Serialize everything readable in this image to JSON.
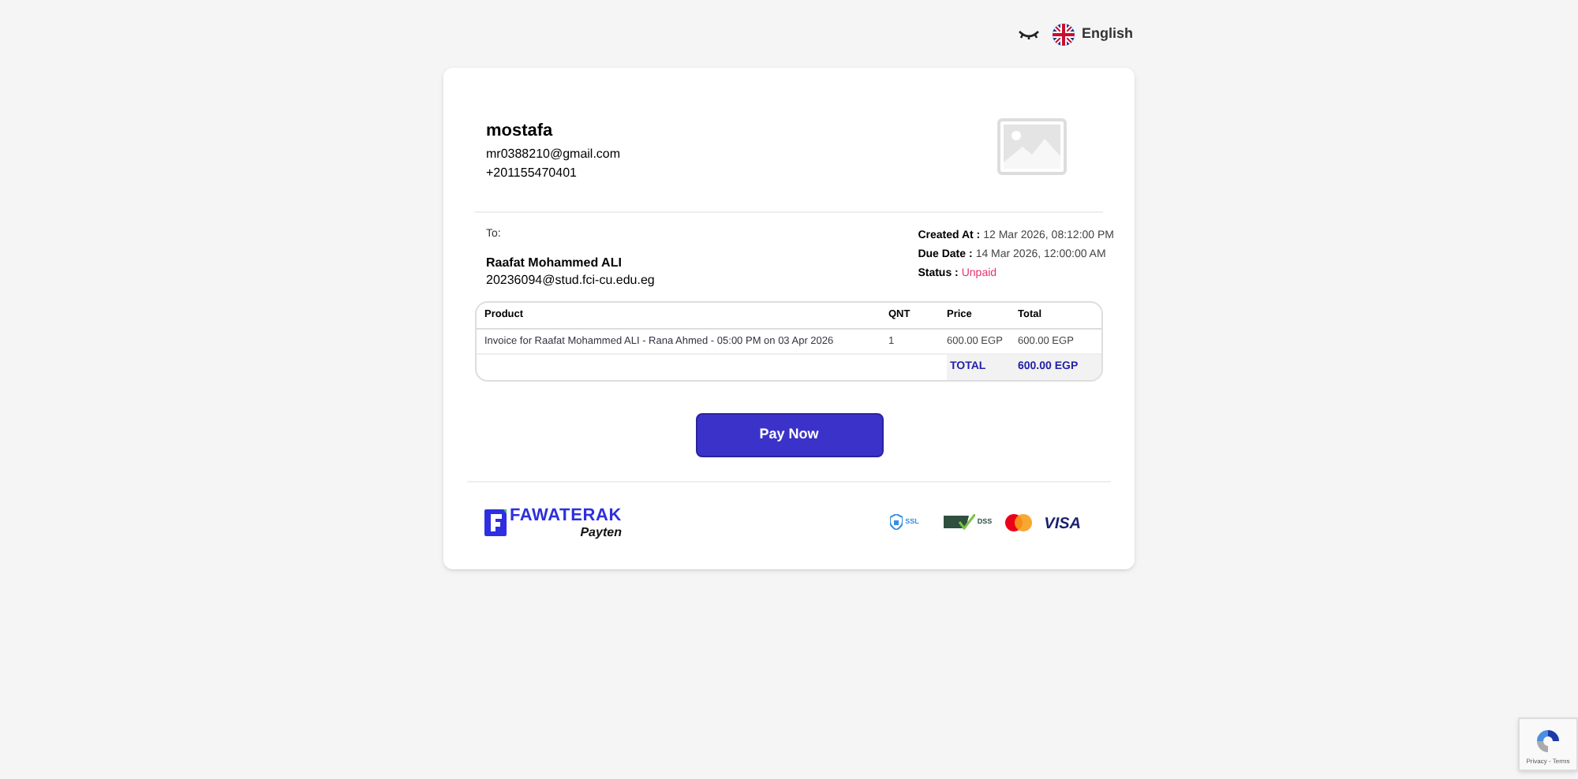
{
  "language": {
    "label": "English"
  },
  "seller": {
    "name": "mostafa",
    "email": "mr0388210@gmail.com",
    "phone": "+201155470401"
  },
  "recipient": {
    "label": "To:",
    "name": "Raafat Mohammed ALI",
    "email": "20236094@stud.fci-cu.edu.eg"
  },
  "meta": [
    {
      "label": "Created At :",
      "value": "12 Mar 2026, 08:12:00 PM",
      "kind": "plain"
    },
    {
      "label": "Due Date :",
      "value": "14 Mar 2026, 12:00:00 AM",
      "kind": "plain"
    },
    {
      "label": "Status :",
      "value": "Unpaid",
      "kind": "alert"
    }
  ],
  "table": {
    "columns": [
      "Product",
      "QNT",
      "Price",
      "Total"
    ],
    "rows": [
      [
        "Invoice for Raafat Mohammed ALI - Rana Ahmed - 05:00 PM on 03 Apr 2026",
        "1",
        "600.00 EGP",
        "600.00 EGP"
      ]
    ],
    "total_label": "TOTAL",
    "total_value": "600.00 EGP"
  },
  "pay_button": "Pay Now",
  "brand": {
    "name": "FAWATERAK",
    "partner": "Payten"
  },
  "badges": [
    {
      "kind": "ssl",
      "label": "SSL"
    },
    {
      "kind": "pci",
      "label": "DSS"
    },
    {
      "kind": "mastercard"
    },
    {
      "kind": "visa",
      "label": "VISA"
    }
  ],
  "recaptcha": {
    "label": "Privacy - Terms"
  }
}
